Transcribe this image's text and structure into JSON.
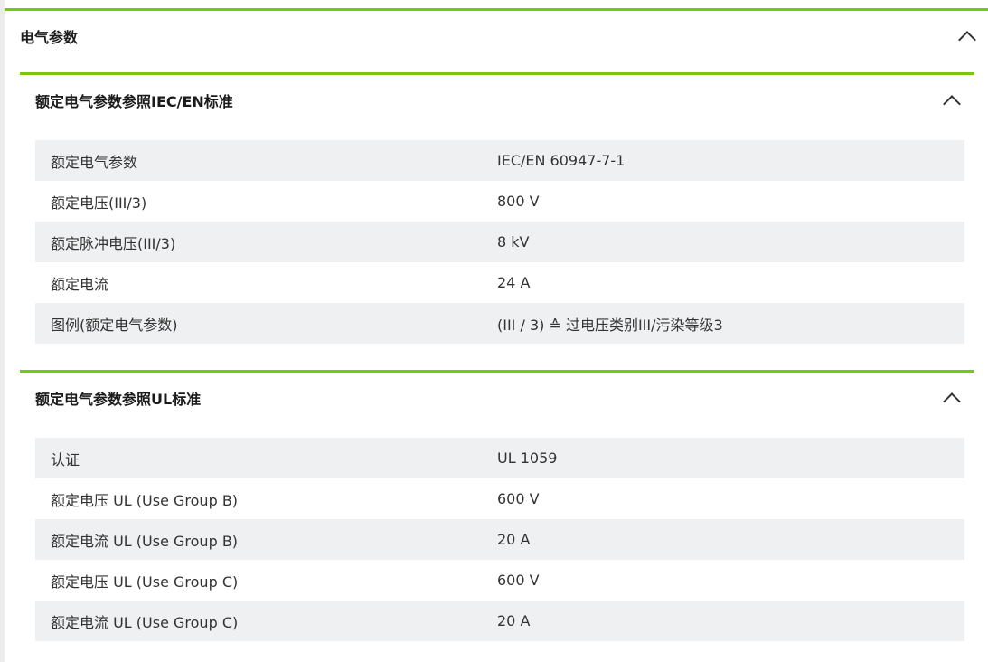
{
  "main": {
    "title": "电气参数"
  },
  "sections": [
    {
      "title": "额定电气参数参照IEC/EN标准",
      "rows": [
        {
          "label": "额定电气参数",
          "value": "IEC/EN 60947-7-1"
        },
        {
          "label": "额定电压(III/3)",
          "value": "800 V"
        },
        {
          "label": "额定脉冲电压(III/3)",
          "value": "8 kV"
        },
        {
          "label": "额定电流",
          "value": "24 A"
        },
        {
          "label": "图例(额定电气参数)",
          "value": "(III / 3) ≙ 过电压类别III/污染等级3"
        }
      ]
    },
    {
      "title": "额定电气参数参照UL标准",
      "rows": [
        {
          "label": "认证",
          "value": "UL 1059"
        },
        {
          "label": "额定电压 UL (Use Group B)",
          "value": "600 V"
        },
        {
          "label": "额定电流 UL (Use Group B)",
          "value": "20 A"
        },
        {
          "label": "额定电压 UL (Use Group C)",
          "value": "600 V"
        },
        {
          "label": "额定电流 UL (Use Group C)",
          "value": "20 A"
        }
      ]
    }
  ],
  "icons": {
    "collapse": "chevron-up-icon"
  },
  "colors": {
    "accent": "#7ac70c",
    "row_stripe": "#eff0f2",
    "text": "#333333"
  }
}
